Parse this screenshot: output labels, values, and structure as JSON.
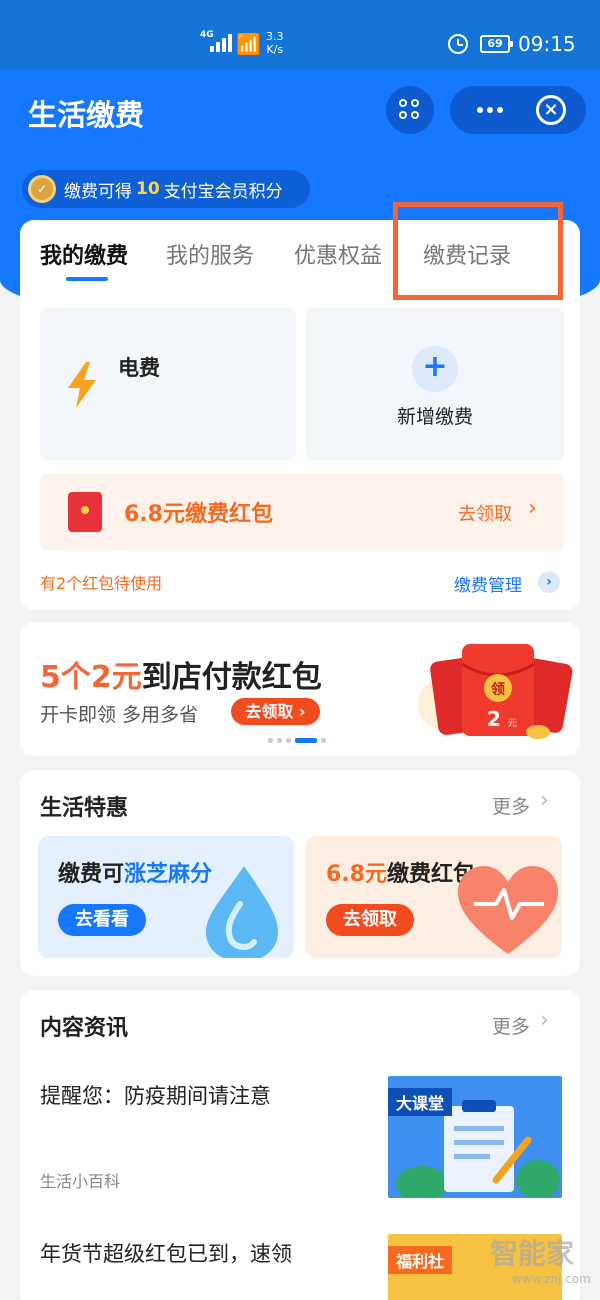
{
  "status_bar": {
    "network": "4G",
    "speed_value": "3.3",
    "speed_unit": "K/s",
    "battery": "69",
    "time": "09:15"
  },
  "header": {
    "title": "生活缴费"
  },
  "reward": {
    "prefix": "缴费可得",
    "points": "10",
    "suffix": "支付宝会员积分"
  },
  "tabs": [
    {
      "label": "我的缴费",
      "active": true
    },
    {
      "label": "我的服务",
      "active": false
    },
    {
      "label": "优惠权益",
      "active": false
    },
    {
      "label": "缴费记录",
      "active": false
    }
  ],
  "bills": {
    "electricity_label": "电费",
    "add_label": "新增缴费"
  },
  "red_packet": {
    "text": "6.8元缴费红包",
    "action": "去领取"
  },
  "pending_text": "有2个红包待使用",
  "manage_label": "缴费管理",
  "banner": {
    "headline_part1": "5个2元",
    "headline_part2": "到店付款红包",
    "subtitle": "开卡即领 多用多省",
    "button": "去领取",
    "envelope_char": "领",
    "envelope_amount": "2",
    "envelope_unit": "元"
  },
  "deals": {
    "title": "生活特惠",
    "more": "更多",
    "items": [
      {
        "title_part1": "缴费可",
        "title_part2": "涨芝麻分",
        "button": "去看看"
      },
      {
        "title_part1": "6.8元",
        "title_part2": "缴费红包",
        "button": "去领取"
      }
    ]
  },
  "news": {
    "title": "内容资讯",
    "more": "更多",
    "items": [
      {
        "title": "提醒您：防疫期间请注意",
        "tag": "生活小百科",
        "thumb_label": "大课堂"
      },
      {
        "title": "年货节超级红包已到，速领",
        "thumb_label": "福利社"
      }
    ]
  },
  "watermark": {
    "text": "智能家",
    "url": "www.znj.com"
  },
  "colors": {
    "brand_blue": "#1677ff",
    "accent_orange": "#f56a1f",
    "highlight": "#f2673a"
  }
}
